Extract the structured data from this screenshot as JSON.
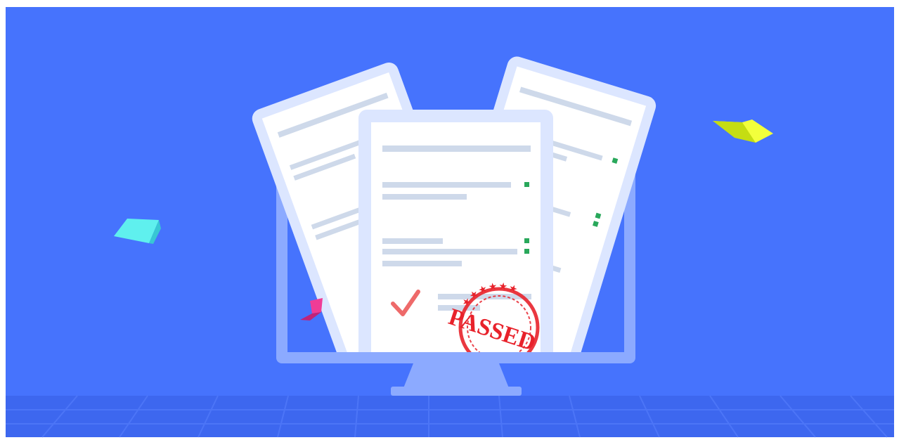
{
  "illustration": {
    "subject": "documents-passed-on-monitor",
    "stamp": {
      "text": "PASSED",
      "color": "#e8222b"
    },
    "colors": {
      "background": "#4673fd",
      "floor": "#3d67ef",
      "monitor": "#8caaff",
      "paper_border": "#dce6ff",
      "paper": "#ffffff",
      "text_line": "#ced9ea",
      "mark": "#29a85b",
      "check": "#ee6a6a",
      "confetti": [
        "#5ff0ee",
        "#f2ff3c",
        "#f03c96"
      ]
    },
    "icons": [
      "checkmark-icon",
      "passed-stamp"
    ]
  }
}
